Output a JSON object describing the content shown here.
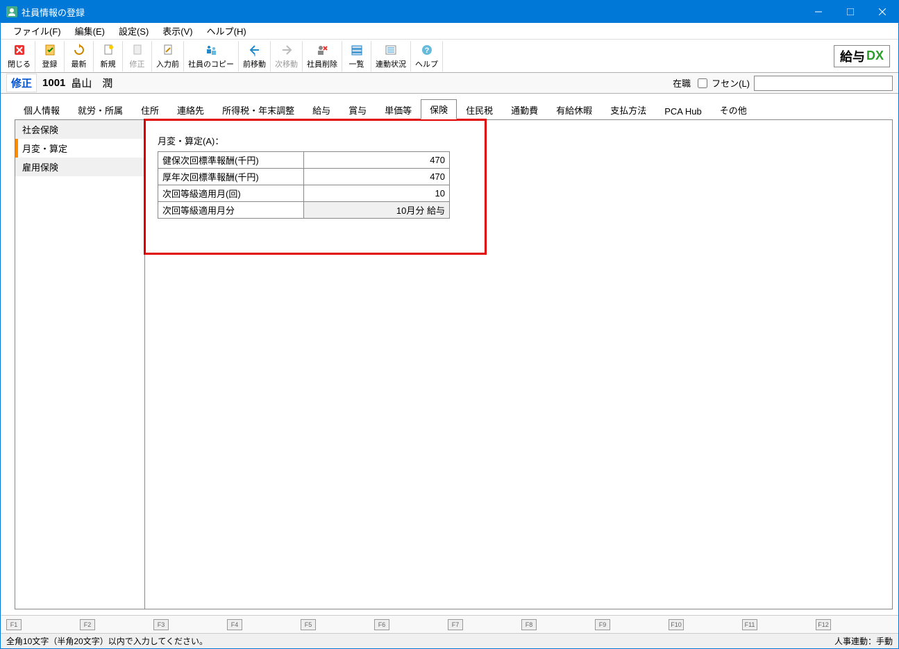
{
  "window": {
    "title": "社員情報の登録"
  },
  "menubar": {
    "file": "ファイル(F)",
    "edit": "編集(E)",
    "settings": "設定(S)",
    "view": "表示(V)",
    "help": "ヘルプ(H)"
  },
  "toolbar": {
    "close": "閉じる",
    "register": "登録",
    "refresh": "最新",
    "new": "新規",
    "modify": "修正",
    "before_input": "入力前",
    "copy_employee": "社員のコピー",
    "prev": "前移動",
    "next": "次移動",
    "delete_employee": "社員削除",
    "list": "一覧",
    "link_status": "連動状況",
    "help": "ヘルプ"
  },
  "brand": {
    "text": "給与",
    "dx": "DX"
  },
  "info": {
    "mode": "修正",
    "id": "1001",
    "name": "畠山　潤",
    "status": "在職",
    "fusen_label": "フセン(L)",
    "fusen_value": ""
  },
  "tabs": [
    "個人情報",
    "就労・所属",
    "住所",
    "連絡先",
    "所得税・年末調整",
    "給与",
    "賞与",
    "単価等",
    "保険",
    "住民税",
    "通勤費",
    "有給休暇",
    "支払方法",
    "PCA Hub",
    "その他"
  ],
  "active_tab": "保険",
  "sidebar": {
    "items": [
      "社会保険",
      "月変・算定",
      "雇用保険"
    ]
  },
  "sidebar_selected": "月変・算定",
  "form": {
    "heading": "月変・算定(A)：",
    "rows": [
      {
        "label": "健保次回標準報酬(千円)",
        "value": "470",
        "readonly": false
      },
      {
        "label": "厚年次回標準報酬(千円)",
        "value": "470",
        "readonly": false
      },
      {
        "label": "次回等級適用月(回)",
        "value": "10",
        "readonly": false
      },
      {
        "label": "次回等級適用月分",
        "value": "10月分 給与",
        "readonly": true
      }
    ]
  },
  "fkeys": [
    "F1",
    "F2",
    "F3",
    "F4",
    "F5",
    "F6",
    "F7",
    "F8",
    "F9",
    "F10",
    "F11",
    "F12"
  ],
  "statusbar": {
    "left": "全角10文字（半角20文字）以内で入力してください。",
    "right": "人事連動：手動"
  }
}
